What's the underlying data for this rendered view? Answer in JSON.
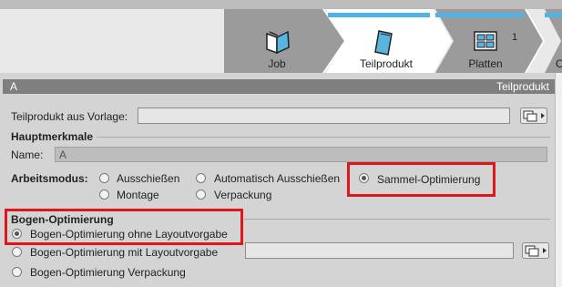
{
  "steps": [
    {
      "label": "Job",
      "icon": "book-icon"
    },
    {
      "label": "Teilprodukt",
      "icon": "document-icon"
    },
    {
      "label": "Platten",
      "icon": "plates-icon",
      "count": "1"
    },
    {
      "label": "C",
      "icon": "generic-icon"
    }
  ],
  "panel": {
    "name": "A",
    "title": "Teilprodukt"
  },
  "template_row": {
    "label": "Teilprodukt aus Vorlage:",
    "value": ""
  },
  "hauptmerkmale": {
    "heading": "Hauptmerkmale",
    "name_label": "Name:",
    "name_value": "A"
  },
  "arbeitsmodus": {
    "label": "Arbeitsmodus:",
    "options": [
      "Ausschießen",
      "Automatisch Ausschießen",
      "Sammel-Optimierung",
      "Montage",
      "Verpackung"
    ],
    "selected": "Sammel-Optimierung"
  },
  "bogen": {
    "heading": "Bogen-Optimierung",
    "options": [
      "Bogen-Optimierung ohne Layoutvorgabe",
      "Bogen-Optimierung mit Layoutvorgabe",
      "Bogen-Optimierung Verpackung"
    ],
    "selected": "Bogen-Optimierung ohne Layoutvorgabe",
    "layout_value": ""
  },
  "colors": {
    "accent": "#4fb3e6",
    "highlight": "#e0161d"
  }
}
